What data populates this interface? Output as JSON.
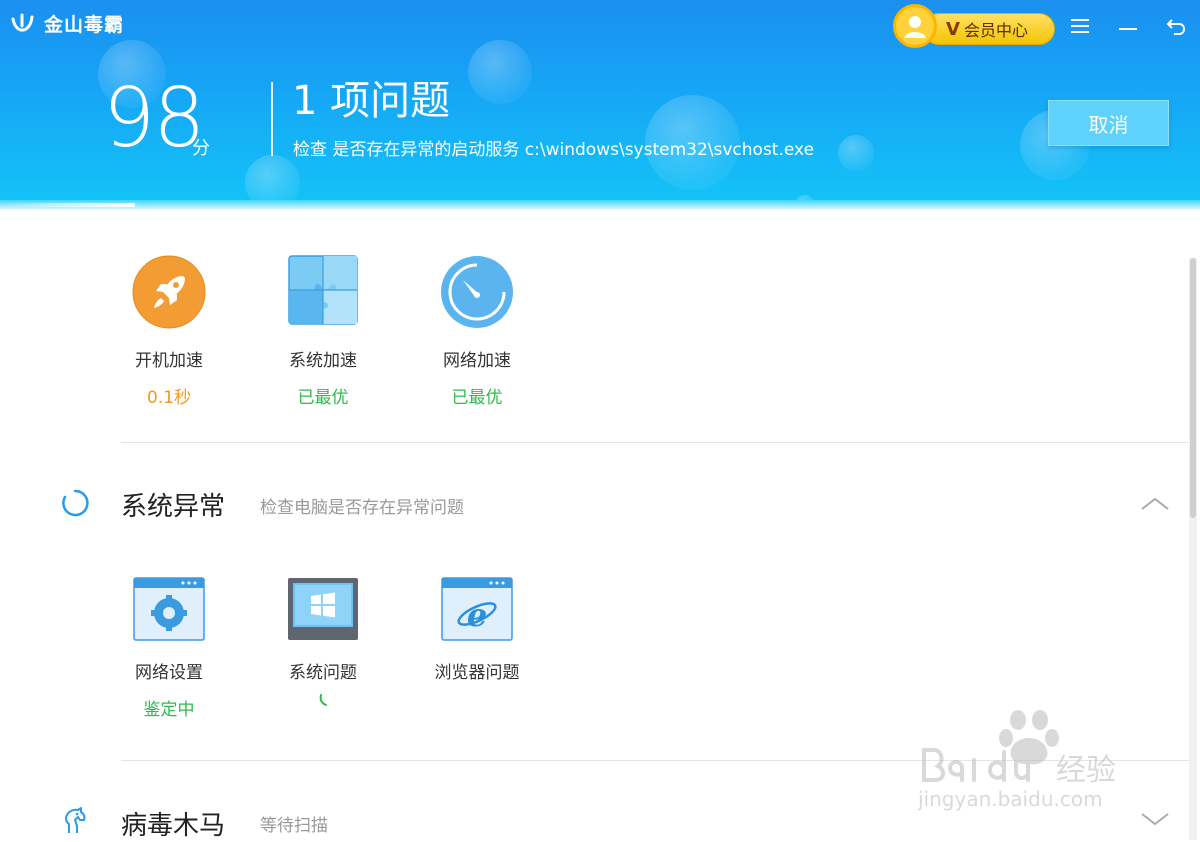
{
  "app": {
    "title": "金山毒霸"
  },
  "vip": {
    "label": "会员中心",
    "badge": "V"
  },
  "window": {
    "menu_icon": "hamburger-menu-icon",
    "minimize_icon": "minimize-icon",
    "back_icon": "back-arrow-icon"
  },
  "header": {
    "score": "98",
    "score_unit": "分",
    "issue_title": "1 项问题",
    "scan_status": "检查 是否存在异常的启动服务 c:\\windows\\system32\\svchost.exe",
    "cancel_label": "取消"
  },
  "speed": {
    "items": [
      {
        "name": "开机加速",
        "status": "0.1秒",
        "icon": "rocket-icon",
        "status_color": "#f29a1b"
      },
      {
        "name": "系统加速",
        "status": "已最优",
        "icon": "puzzle-icon",
        "status_color": "#2fba4b"
      },
      {
        "name": "网络加速",
        "status": "已最优",
        "icon": "speedometer-icon",
        "status_color": "#2fba4b"
      }
    ]
  },
  "sections": [
    {
      "title": "系统异常",
      "subtitle": "检查电脑是否存在异常问题",
      "icon": "loading-spinner-icon",
      "expanded": true,
      "items": [
        {
          "name": "网络设置",
          "status": "鉴定中",
          "icon": "settings-window-icon"
        },
        {
          "name": "系统问题",
          "status": "",
          "icon": "windows-monitor-icon"
        },
        {
          "name": "浏览器问题",
          "status": "",
          "icon": "ie-browser-icon"
        }
      ]
    },
    {
      "title": "病毒木马",
      "subtitle": "等待扫描",
      "icon": "trojan-horse-icon",
      "expanded": false
    }
  ],
  "colors": {
    "header_blue": "#1a8ff0",
    "accent_orange": "#f29a1b",
    "accent_green": "#2fba4b",
    "vip_gold": "#f5c400"
  }
}
